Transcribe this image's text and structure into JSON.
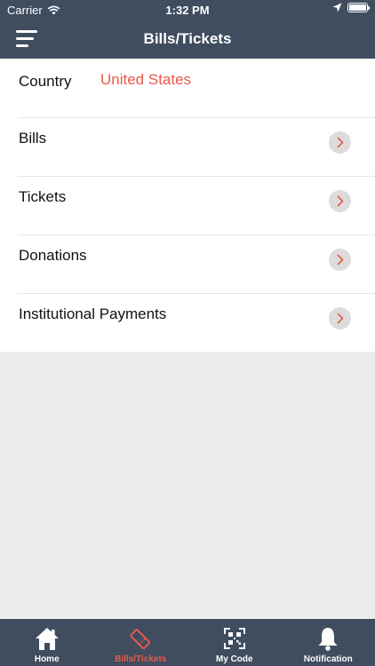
{
  "status_bar": {
    "carrier": "Carrier",
    "time": "1:32 PM"
  },
  "nav": {
    "title": "Bills/Tickets"
  },
  "country": {
    "label": "Country",
    "value": "United States"
  },
  "menu_items": [
    {
      "label": "Bills"
    },
    {
      "label": "Tickets"
    },
    {
      "label": "Donations"
    },
    {
      "label": "Institutional Payments"
    }
  ],
  "tabbar": {
    "tabs": [
      {
        "label": "Home",
        "icon": "home-icon"
      },
      {
        "label": "Bills/Tickets",
        "icon": "ticket-icon",
        "active": true
      },
      {
        "label": "My Code",
        "icon": "qr-code-icon"
      },
      {
        "label": "Notification",
        "icon": "bell-icon"
      }
    ]
  },
  "colors": {
    "header": "#3f4d5f",
    "accent": "#e8584c",
    "background": "#ececec"
  }
}
